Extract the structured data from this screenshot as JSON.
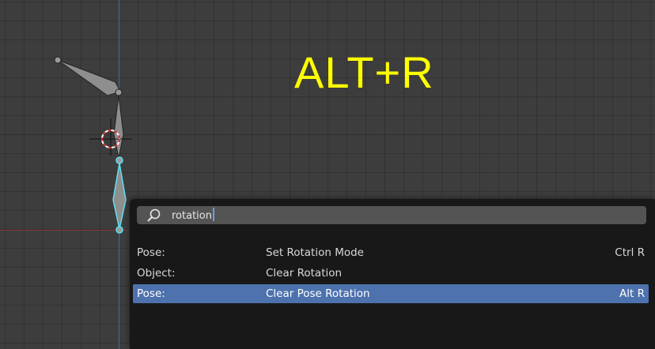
{
  "overlay": {
    "shortcut_hint": "ALT+R",
    "color": "#ffff00"
  },
  "search": {
    "query": "rotation",
    "icon": "search-icon"
  },
  "results": [
    {
      "category": "Pose:",
      "name": "Set Rotation Mode",
      "shortcut": "Ctrl R",
      "selected": false
    },
    {
      "category": "Object:",
      "name": "Clear Rotation",
      "shortcut": "",
      "selected": false
    },
    {
      "category": "Pose:",
      "name": "Clear Pose Rotation",
      "shortcut": "Alt R",
      "selected": true
    }
  ],
  "colors": {
    "viewport_bg": "#3d3d3d",
    "menu_bg": "#181818",
    "selection": "#4d72ad",
    "active_bone_outline": "#5ee0f0",
    "axis_x": "#8a3a3a",
    "axis_y": "#3b6fa8"
  }
}
